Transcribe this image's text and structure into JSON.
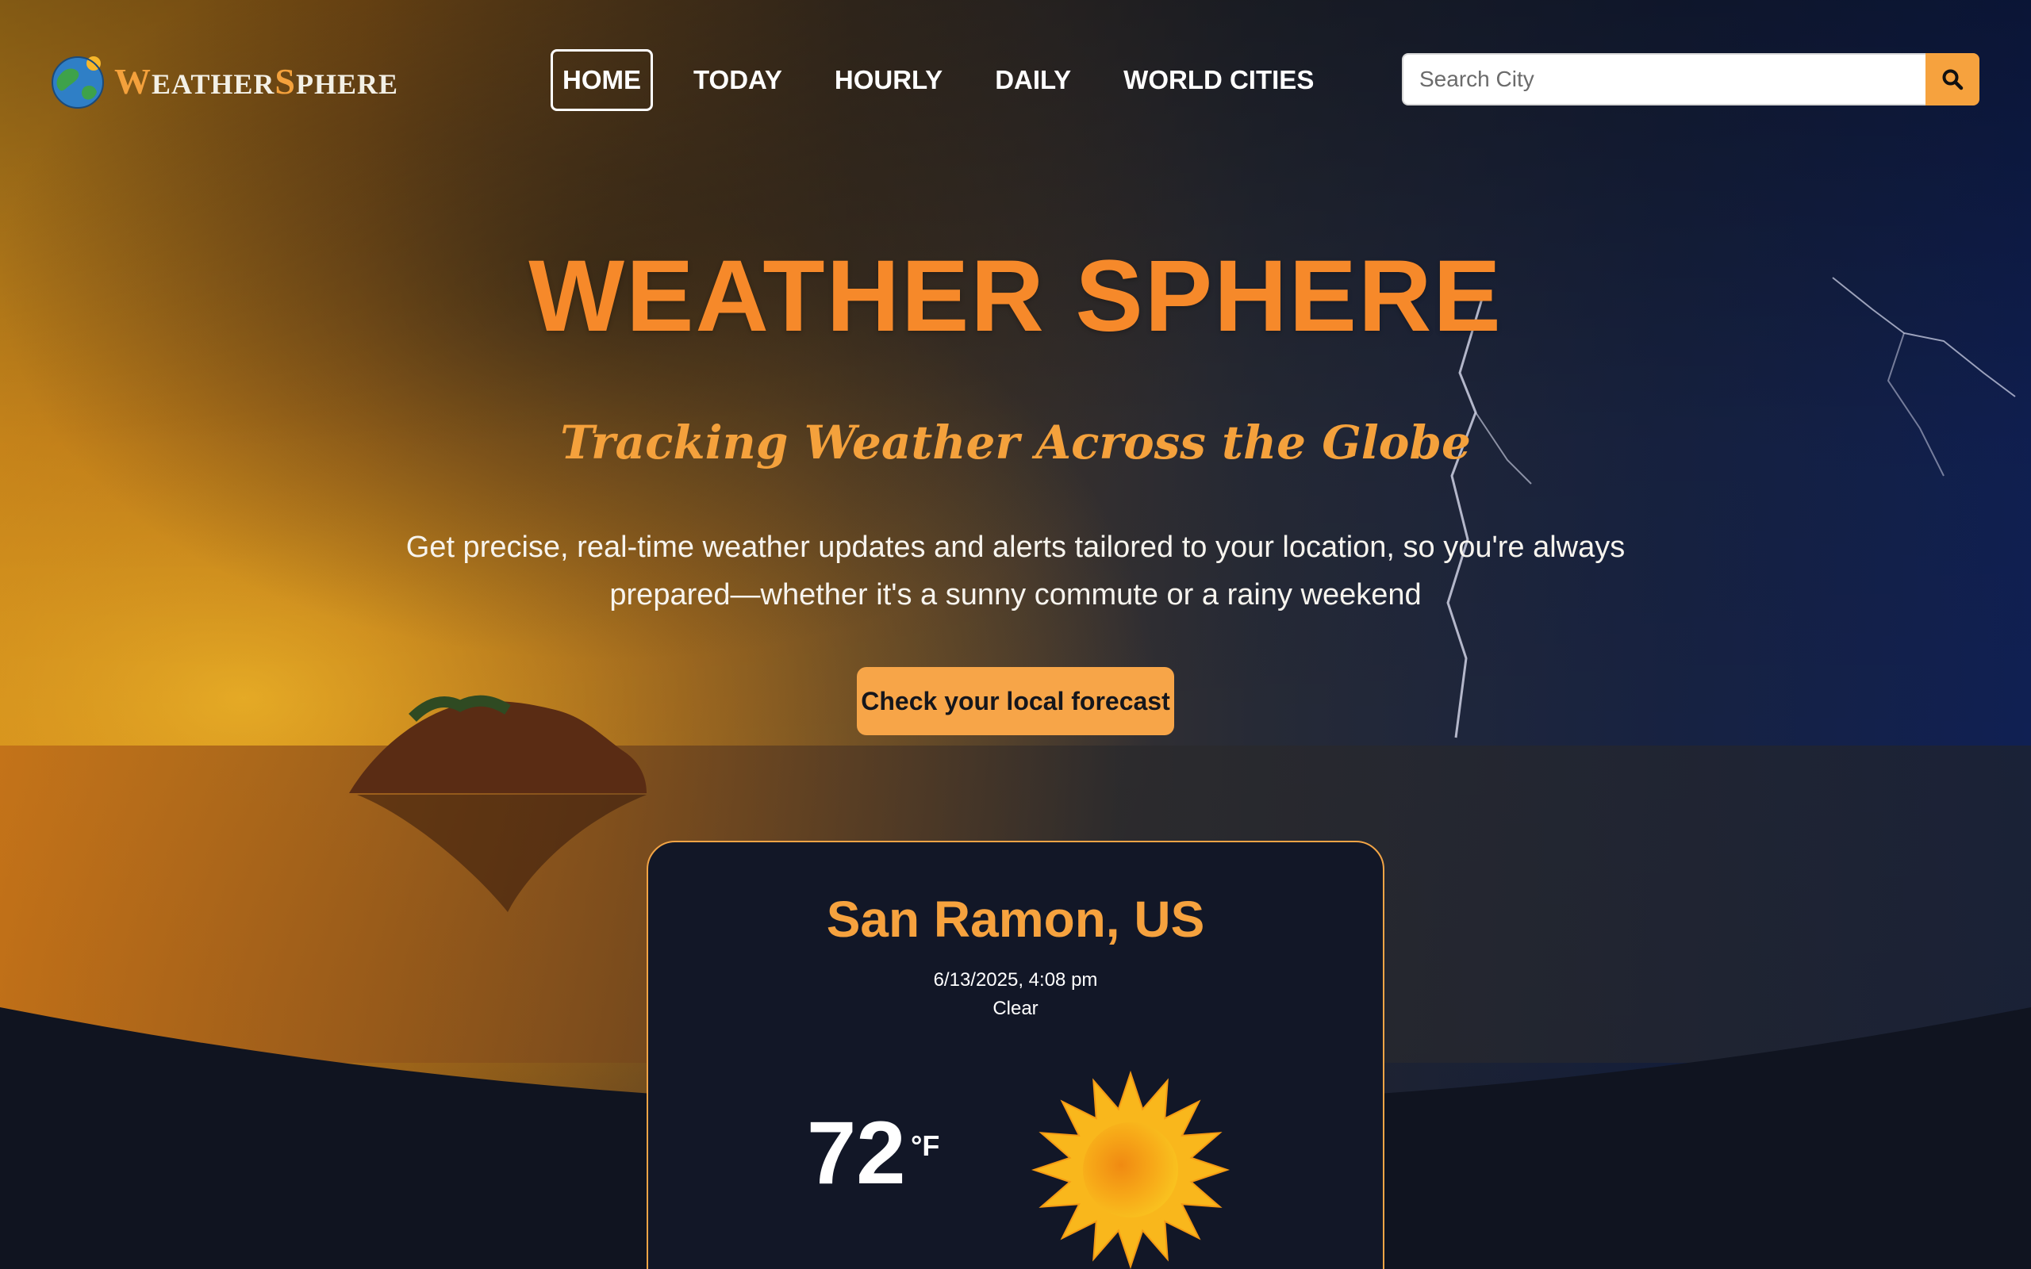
{
  "header": {
    "logo": {
      "first_letter": "W",
      "first_rest": "EATHER",
      "second_letter": "S",
      "second_rest": "PHERE",
      "icon": "globe-icon"
    },
    "nav": [
      {
        "label": "HOME",
        "active": true
      },
      {
        "label": "TODAY",
        "active": false
      },
      {
        "label": "HOURLY",
        "active": false
      },
      {
        "label": "DAILY",
        "active": false
      },
      {
        "label": "WORLD CITIES",
        "active": false
      }
    ],
    "search": {
      "placeholder": "Search City",
      "value": "",
      "button_icon": "search-icon"
    }
  },
  "hero": {
    "title": "WEATHER SPHERE",
    "tagline": "Tracking Weather Across the Globe",
    "description": "Get precise, real-time weather updates and alerts tailored to your location, so you're always prepared—whether it's a sunny commute or a rainy weekend",
    "cta_label": "Check your local forecast"
  },
  "weather": {
    "city": "San Ramon, US",
    "datetime": "6/13/2025, 4:08 pm",
    "condition": "Clear",
    "temperature": "72",
    "unit": "°F",
    "icon": "sun-icon"
  },
  "colors": {
    "accent": "#f6a23e",
    "title_orange": "#f6892a",
    "dark_bg": "#101420",
    "card_bg": "#121727"
  }
}
